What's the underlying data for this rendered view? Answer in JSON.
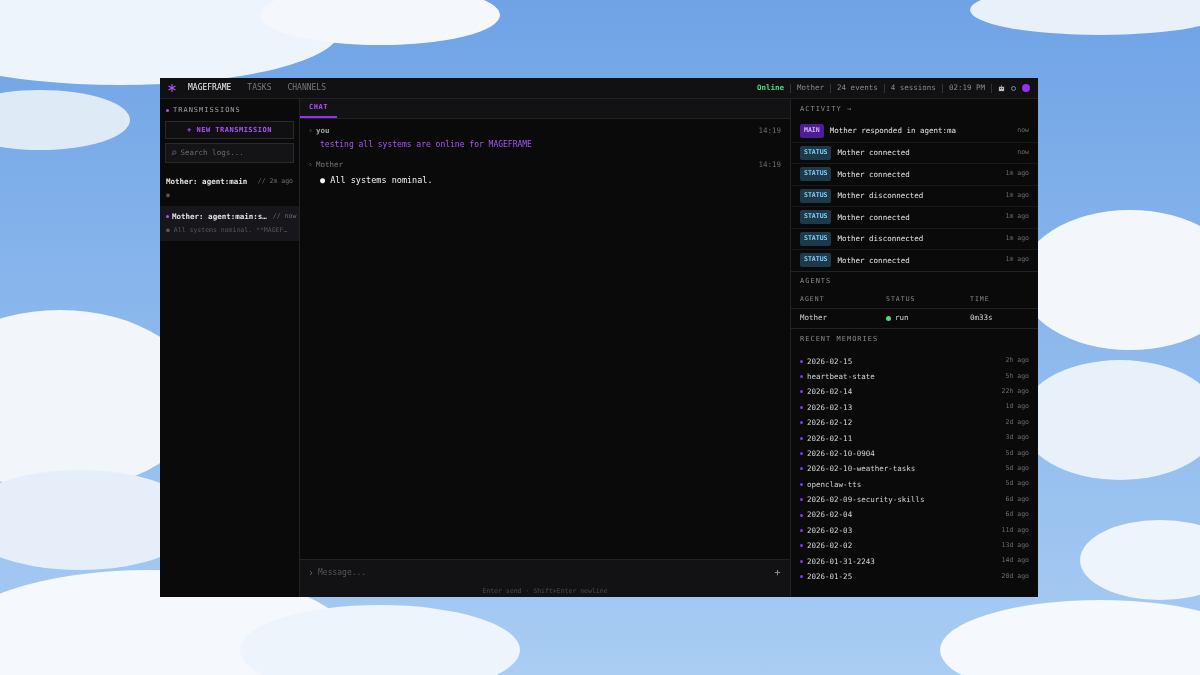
{
  "nav": [
    {
      "label": "MAGEFRAME",
      "selected": true
    },
    {
      "label": "TASKS",
      "selected": false
    },
    {
      "label": "CHANNELS",
      "selected": false
    }
  ],
  "status_bar": {
    "connection": "Online",
    "agent": "Mother",
    "events": "24 events",
    "sessions": "4 sessions",
    "time": "02:19 PM"
  },
  "sidebar": {
    "title": "TRANSMISSIONS",
    "new_button": "+ NEW TRANSMISSION",
    "search": {
      "placeholder": "Search logs..."
    },
    "sessions": [
      {
        "title": "Mother: agent:main",
        "time": "// 2m ago",
        "preview": "●",
        "selected": false
      },
      {
        "title": "Mother: agent:main:s…",
        "time": "// now",
        "preview": "● All systems nominal. **MAGEF…",
        "selected": true
      }
    ]
  },
  "chat": {
    "tab": {
      "label": "CHAT",
      "selected": true
    },
    "messages": [
      {
        "sender": "you",
        "time": "14:19",
        "text": "testing all systems are online for MAGEFRAME",
        "kind": "user"
      },
      {
        "sender": "Mother",
        "time": "14:19",
        "text": "● All systems nominal.",
        "kind": "agent"
      }
    ],
    "input": {
      "placeholder": "Message..."
    },
    "hint": "Enter send · Shift+Enter newline"
  },
  "activity": {
    "title": "ACTIVITY →",
    "events": [
      {
        "tag": "MAIN",
        "kind": "main",
        "text": "Mother responded in agent:ma",
        "time": "now"
      },
      {
        "tag": "STATUS",
        "kind": "status",
        "text": "Mother connected",
        "time": "now"
      },
      {
        "tag": "STATUS",
        "kind": "status",
        "text": "Mother connected",
        "time": "1m ago"
      },
      {
        "tag": "STATUS",
        "kind": "status",
        "text": "Mother disconnected",
        "time": "1m ago"
      },
      {
        "tag": "STATUS",
        "kind": "status",
        "text": "Mother connected",
        "time": "1m ago"
      },
      {
        "tag": "STATUS",
        "kind": "status",
        "text": "Mother disconnected",
        "time": "1m ago"
      },
      {
        "tag": "STATUS",
        "kind": "status",
        "text": "Mother connected",
        "time": "1m ago"
      }
    ]
  },
  "agents": {
    "title": "AGENTS",
    "columns": [
      "AGENT",
      "STATUS",
      "TIME"
    ],
    "rows": [
      {
        "agent": "Mother",
        "status": "run",
        "time": "0m33s",
        "color": "#4ade80"
      }
    ]
  },
  "memories": {
    "title": "RECENT MEMORIES",
    "items": [
      {
        "name": "2026-02-15",
        "time": "2h ago"
      },
      {
        "name": "heartbeat-state",
        "time": "5h ago"
      },
      {
        "name": "2026-02-14",
        "time": "22h ago"
      },
      {
        "name": "2026-02-13",
        "time": "1d ago"
      },
      {
        "name": "2026-02-12",
        "time": "2d ago"
      },
      {
        "name": "2026-02-11",
        "time": "3d ago"
      },
      {
        "name": "2026-02-10-0904",
        "time": "5d ago"
      },
      {
        "name": "2026-02-10-weather-tasks",
        "time": "5d ago"
      },
      {
        "name": "openclaw-tts",
        "time": "5d ago"
      },
      {
        "name": "2026-02-09-security-skills",
        "time": "6d ago"
      },
      {
        "name": "2026-02-04",
        "time": "6d ago"
      },
      {
        "name": "2026-02-03",
        "time": "11d ago"
      },
      {
        "name": "2026-02-02",
        "time": "13d ago"
      },
      {
        "name": "2026-01-31-2243",
        "time": "14d ago"
      },
      {
        "name": "2026-01-25",
        "time": "20d ago"
      }
    ]
  }
}
